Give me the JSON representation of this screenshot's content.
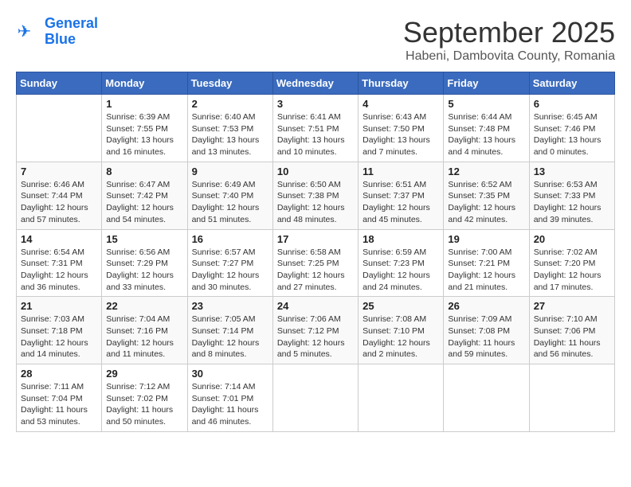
{
  "header": {
    "logo_line1": "General",
    "logo_line2": "Blue",
    "month": "September 2025",
    "location": "Habeni, Dambovita County, Romania"
  },
  "weekdays": [
    "Sunday",
    "Monday",
    "Tuesday",
    "Wednesday",
    "Thursday",
    "Friday",
    "Saturday"
  ],
  "weeks": [
    [
      {
        "day": "",
        "info": ""
      },
      {
        "day": "1",
        "info": "Sunrise: 6:39 AM\nSunset: 7:55 PM\nDaylight: 13 hours\nand 16 minutes."
      },
      {
        "day": "2",
        "info": "Sunrise: 6:40 AM\nSunset: 7:53 PM\nDaylight: 13 hours\nand 13 minutes."
      },
      {
        "day": "3",
        "info": "Sunrise: 6:41 AM\nSunset: 7:51 PM\nDaylight: 13 hours\nand 10 minutes."
      },
      {
        "day": "4",
        "info": "Sunrise: 6:43 AM\nSunset: 7:50 PM\nDaylight: 13 hours\nand 7 minutes."
      },
      {
        "day": "5",
        "info": "Sunrise: 6:44 AM\nSunset: 7:48 PM\nDaylight: 13 hours\nand 4 minutes."
      },
      {
        "day": "6",
        "info": "Sunrise: 6:45 AM\nSunset: 7:46 PM\nDaylight: 13 hours\nand 0 minutes."
      }
    ],
    [
      {
        "day": "7",
        "info": "Sunrise: 6:46 AM\nSunset: 7:44 PM\nDaylight: 12 hours\nand 57 minutes."
      },
      {
        "day": "8",
        "info": "Sunrise: 6:47 AM\nSunset: 7:42 PM\nDaylight: 12 hours\nand 54 minutes."
      },
      {
        "day": "9",
        "info": "Sunrise: 6:49 AM\nSunset: 7:40 PM\nDaylight: 12 hours\nand 51 minutes."
      },
      {
        "day": "10",
        "info": "Sunrise: 6:50 AM\nSunset: 7:38 PM\nDaylight: 12 hours\nand 48 minutes."
      },
      {
        "day": "11",
        "info": "Sunrise: 6:51 AM\nSunset: 7:37 PM\nDaylight: 12 hours\nand 45 minutes."
      },
      {
        "day": "12",
        "info": "Sunrise: 6:52 AM\nSunset: 7:35 PM\nDaylight: 12 hours\nand 42 minutes."
      },
      {
        "day": "13",
        "info": "Sunrise: 6:53 AM\nSunset: 7:33 PM\nDaylight: 12 hours\nand 39 minutes."
      }
    ],
    [
      {
        "day": "14",
        "info": "Sunrise: 6:54 AM\nSunset: 7:31 PM\nDaylight: 12 hours\nand 36 minutes."
      },
      {
        "day": "15",
        "info": "Sunrise: 6:56 AM\nSunset: 7:29 PM\nDaylight: 12 hours\nand 33 minutes."
      },
      {
        "day": "16",
        "info": "Sunrise: 6:57 AM\nSunset: 7:27 PM\nDaylight: 12 hours\nand 30 minutes."
      },
      {
        "day": "17",
        "info": "Sunrise: 6:58 AM\nSunset: 7:25 PM\nDaylight: 12 hours\nand 27 minutes."
      },
      {
        "day": "18",
        "info": "Sunrise: 6:59 AM\nSunset: 7:23 PM\nDaylight: 12 hours\nand 24 minutes."
      },
      {
        "day": "19",
        "info": "Sunrise: 7:00 AM\nSunset: 7:21 PM\nDaylight: 12 hours\nand 21 minutes."
      },
      {
        "day": "20",
        "info": "Sunrise: 7:02 AM\nSunset: 7:20 PM\nDaylight: 12 hours\nand 17 minutes."
      }
    ],
    [
      {
        "day": "21",
        "info": "Sunrise: 7:03 AM\nSunset: 7:18 PM\nDaylight: 12 hours\nand 14 minutes."
      },
      {
        "day": "22",
        "info": "Sunrise: 7:04 AM\nSunset: 7:16 PM\nDaylight: 12 hours\nand 11 minutes."
      },
      {
        "day": "23",
        "info": "Sunrise: 7:05 AM\nSunset: 7:14 PM\nDaylight: 12 hours\nand 8 minutes."
      },
      {
        "day": "24",
        "info": "Sunrise: 7:06 AM\nSunset: 7:12 PM\nDaylight: 12 hours\nand 5 minutes."
      },
      {
        "day": "25",
        "info": "Sunrise: 7:08 AM\nSunset: 7:10 PM\nDaylight: 12 hours\nand 2 minutes."
      },
      {
        "day": "26",
        "info": "Sunrise: 7:09 AM\nSunset: 7:08 PM\nDaylight: 11 hours\nand 59 minutes."
      },
      {
        "day": "27",
        "info": "Sunrise: 7:10 AM\nSunset: 7:06 PM\nDaylight: 11 hours\nand 56 minutes."
      }
    ],
    [
      {
        "day": "28",
        "info": "Sunrise: 7:11 AM\nSunset: 7:04 PM\nDaylight: 11 hours\nand 53 minutes."
      },
      {
        "day": "29",
        "info": "Sunrise: 7:12 AM\nSunset: 7:02 PM\nDaylight: 11 hours\nand 50 minutes."
      },
      {
        "day": "30",
        "info": "Sunrise: 7:14 AM\nSunset: 7:01 PM\nDaylight: 11 hours\nand 46 minutes."
      },
      {
        "day": "",
        "info": ""
      },
      {
        "day": "",
        "info": ""
      },
      {
        "day": "",
        "info": ""
      },
      {
        "day": "",
        "info": ""
      }
    ]
  ]
}
